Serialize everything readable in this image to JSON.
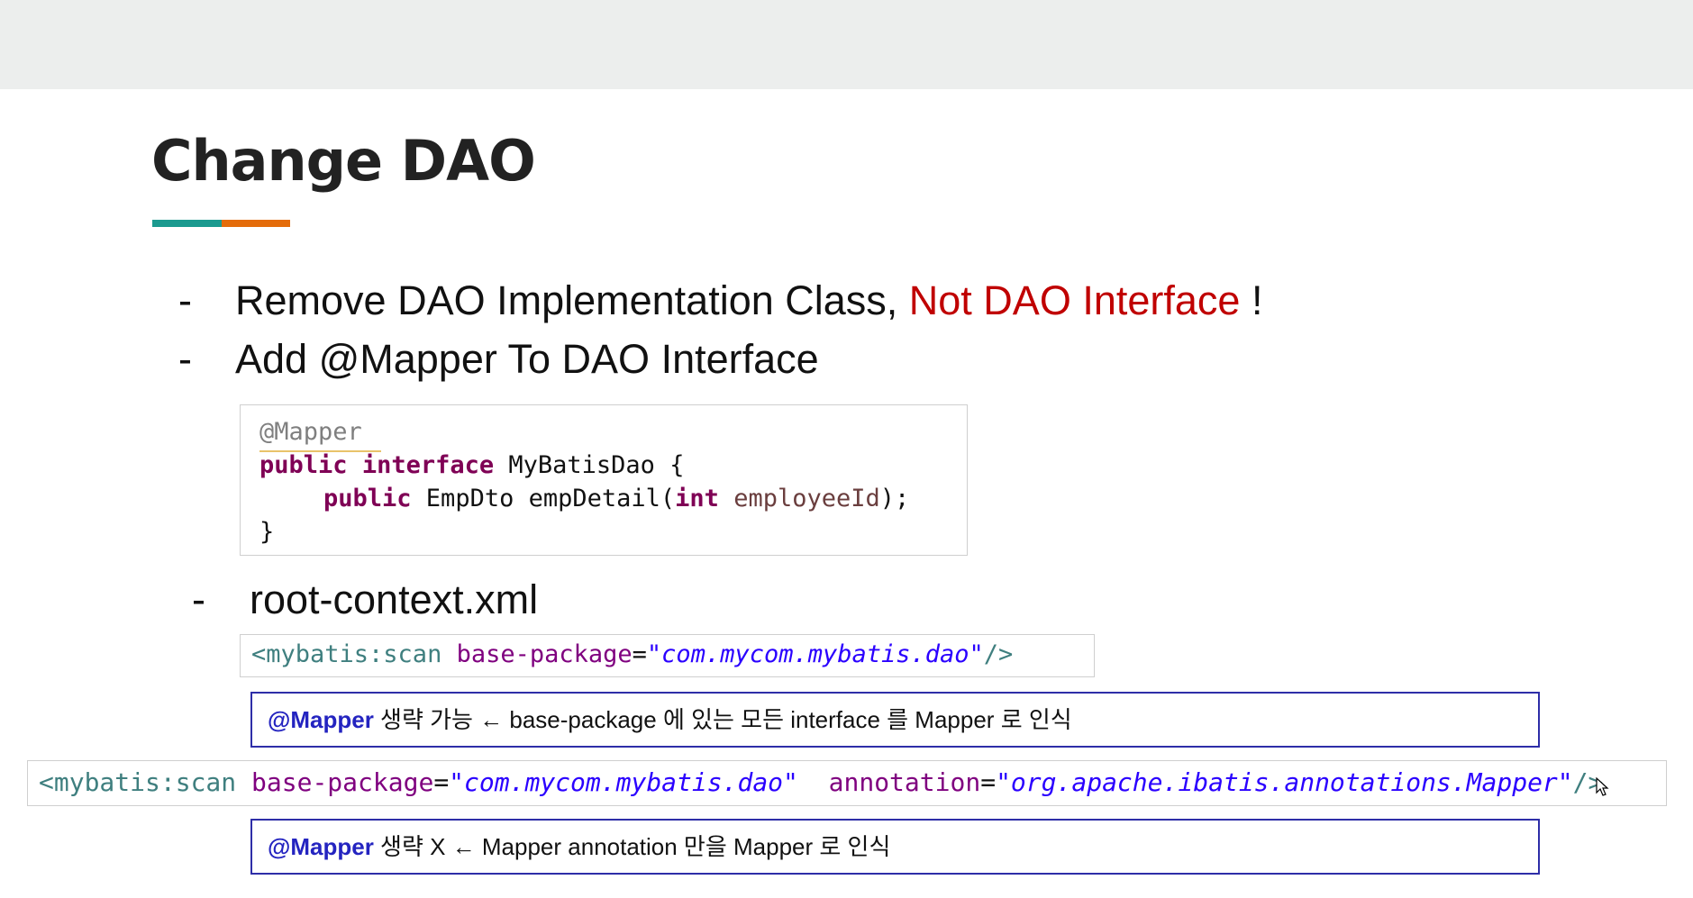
{
  "slide": {
    "title": "Change DAO",
    "accent_colors": {
      "teal": "#1b9a8f",
      "orange": "#e46c0a"
    },
    "bullets": [
      {
        "dash": "-",
        "text_before": "Remove DAO Implementation Class, ",
        "highlight": "Not DAO Interface",
        "text_after": " !"
      },
      {
        "dash": "-",
        "text": "Add @Mapper To DAO Interface"
      },
      {
        "dash": "-",
        "text": "root-context.xml"
      }
    ],
    "java_code": {
      "annotation": "@Mapper",
      "line1_kw1": "public",
      "line1_kw2": "interface",
      "line1_rest": " MyBatisDao {",
      "line2_kw": "public",
      "line2_mid": " EmpDto empDetail(",
      "line2_kw_int": "int",
      "line2_param": " employeeId",
      "line2_end": ");",
      "line3": "}"
    },
    "xml_scan_1": {
      "tag_open": "<mybatis:scan",
      "attr": " base-package",
      "eq": "=",
      "value": "\"com.mycom.mybatis.dao\"",
      "tag_close": "/>"
    },
    "note_1": {
      "mapper": "@Mapper",
      "text": " 생략 가능 ← base-package 에 있는 모든 interface 를 Mapper 로 인식"
    },
    "xml_scan_2": {
      "tag_open": "<mybatis:scan",
      "attr1": " base-package",
      "eq1": "=",
      "value1": "\"com.mycom.mybatis.dao\"",
      "attr2": "  annotation",
      "eq2": "=",
      "value2": "\"org.apache.ibatis.annotations.Mapper\"",
      "tag_close": "/>"
    },
    "note_2": {
      "mapper": "@Mapper",
      "text": " 생략 X ← Mapper annotation 만을 Mapper 로 인식"
    }
  }
}
